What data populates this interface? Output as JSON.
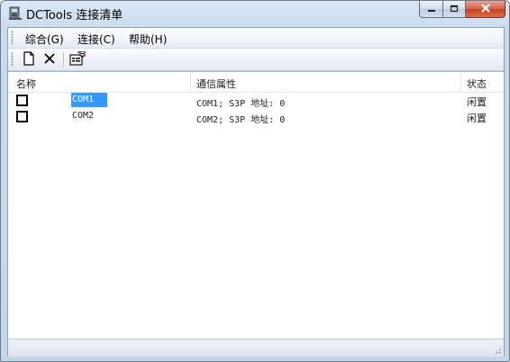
{
  "window": {
    "title": "DCTools 连接清单",
    "app_icon": "dctools-app-icon",
    "controls": [
      "minimize-icon",
      "maximize-icon",
      "close-icon"
    ]
  },
  "menubar": {
    "items": [
      {
        "label": "综合(G)"
      },
      {
        "label": "连接(C)"
      },
      {
        "label": "帮助(H)"
      }
    ]
  },
  "toolbar": {
    "buttons": [
      {
        "icon": "new-document-icon"
      },
      {
        "icon": "delete-icon"
      },
      {
        "icon": "properties-icon"
      }
    ]
  },
  "list": {
    "columns": [
      "名称",
      "通信属性",
      "状态"
    ],
    "rows": [
      {
        "checked": false,
        "name": "COM1",
        "properties": "COM1; S3P 地址: 0",
        "status": "闲置",
        "selected": true
      },
      {
        "checked": false,
        "name": "COM2",
        "properties": "COM2; S3P 地址: 0",
        "status": "闲置",
        "selected": false
      }
    ]
  },
  "colors": {
    "selection": "#3399ff",
    "close_button": "#c8432a",
    "frame": "#c4d7ea"
  }
}
